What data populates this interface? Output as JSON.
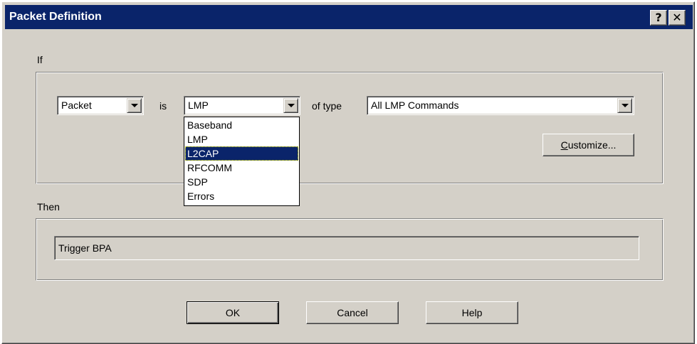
{
  "window": {
    "title": "Packet Definition",
    "help_button": "?",
    "close_button": "✕"
  },
  "if_section": {
    "label": "If",
    "packet_combo": {
      "value": "Packet"
    },
    "is_label": "is",
    "protocol_combo": {
      "value": "LMP"
    },
    "of_type_label": "of type",
    "type_combo": {
      "value": "All LMP Commands"
    },
    "customize_button": {
      "mnemonic": "C",
      "rest": "ustomize..."
    },
    "protocol_dropdown": {
      "items": [
        "Baseband",
        "LMP",
        "L2CAP",
        "RFCOMM",
        "SDP",
        "Errors"
      ],
      "highlighted": "L2CAP"
    }
  },
  "then_section": {
    "label": "Then",
    "action_value": "Trigger BPA"
  },
  "buttons": {
    "ok": "OK",
    "cancel": "Cancel",
    "help": "Help"
  },
  "colors": {
    "titlebar": "#0a246a",
    "dialog_face": "#d4d0c8",
    "selection": "#0a246a"
  }
}
